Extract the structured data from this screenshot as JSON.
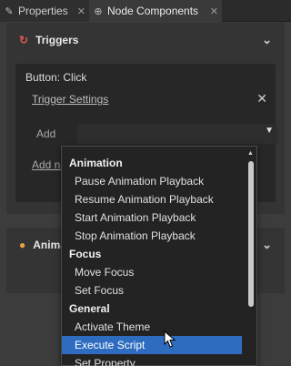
{
  "tabs": [
    {
      "icon": "wrench-icon",
      "label": "Properties",
      "close": "✕"
    },
    {
      "icon": "components-icon",
      "label": "Node Components",
      "close": "✕"
    }
  ],
  "triggers_panel": {
    "title": "Triggers",
    "card": {
      "title": "Button: Click",
      "trigger_settings": "Trigger Settings",
      "close": "✕",
      "add_label": "Add",
      "add_new": "Add new"
    }
  },
  "animations_panel": {
    "title": "Animations"
  },
  "dropdown": {
    "groups": [
      {
        "label": "Animation",
        "items": [
          "Pause Animation Playback",
          "Resume Animation Playback",
          "Start Animation Playback",
          "Stop Animation Playback"
        ]
      },
      {
        "label": "Focus",
        "items": [
          "Move Focus",
          "Set Focus"
        ]
      },
      {
        "label": "General",
        "items": [
          "Activate Theme",
          "Execute Script",
          "Set Property"
        ]
      }
    ],
    "selected": "Execute Script"
  },
  "colors": {
    "selection": "#2e6cc0",
    "trigger_icon": "#e0584e",
    "animation_icon": "#e8a53a"
  }
}
